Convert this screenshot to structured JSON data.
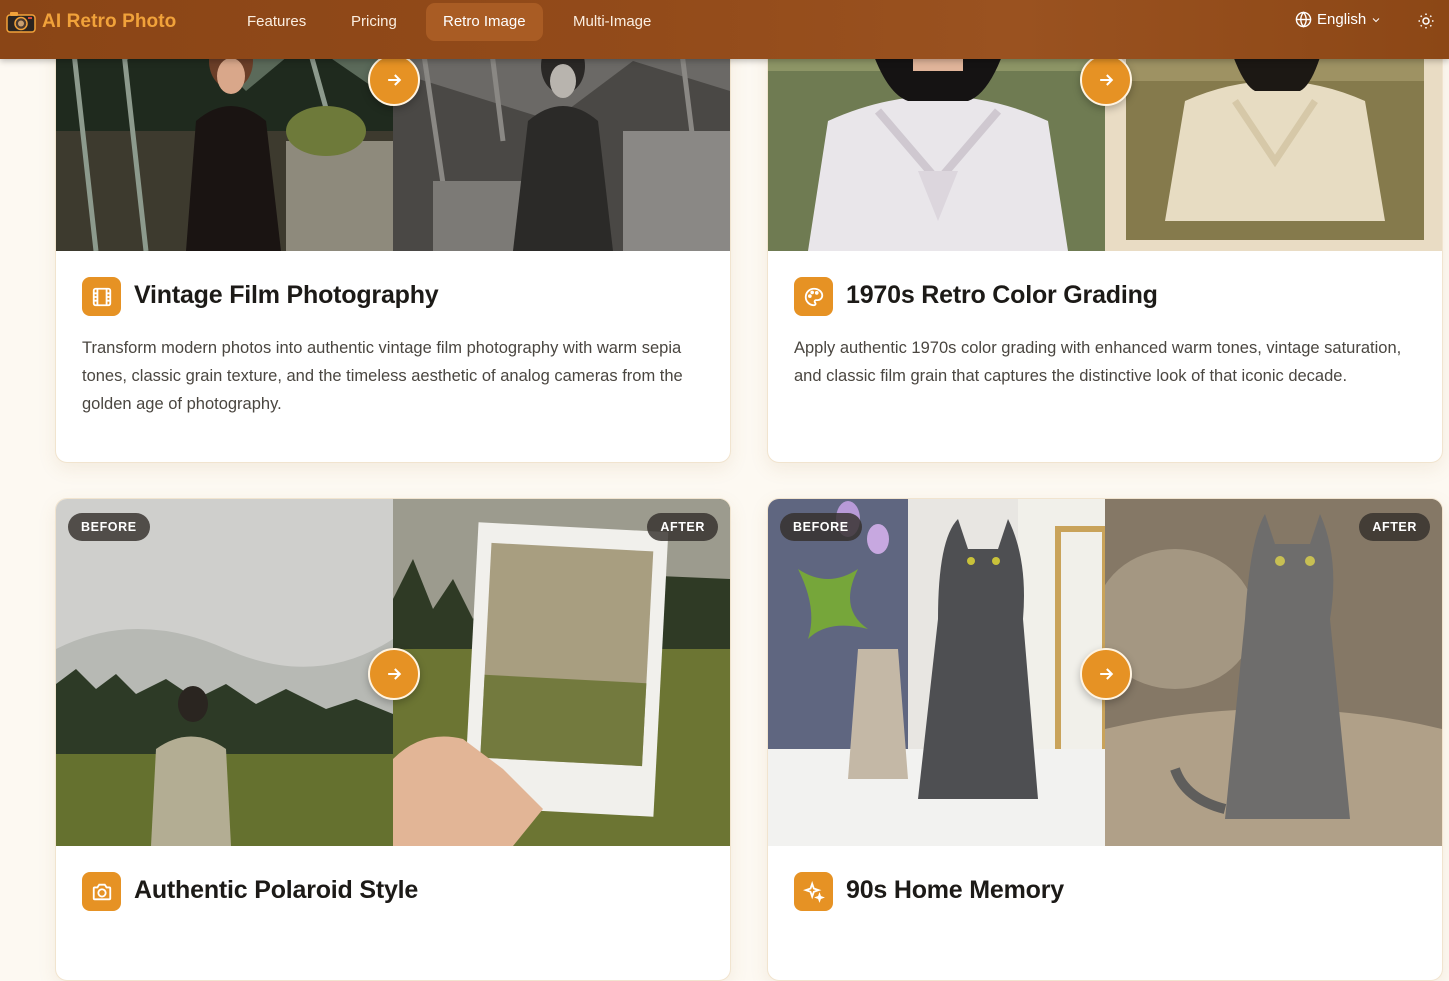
{
  "brand": {
    "name": "AI Retro Photo",
    "icon": "camera-icon"
  },
  "nav": {
    "items": [
      {
        "label": "Features",
        "active": false
      },
      {
        "label": "Pricing",
        "active": false
      },
      {
        "label": "Retro Image",
        "active": true
      },
      {
        "label": "Multi-Image",
        "active": false
      }
    ],
    "language": "English",
    "theme_icon": "sun-icon"
  },
  "colors": {
    "accent": "#e69224",
    "nav_bg": "#934b1a",
    "brand_text": "#f1a23a",
    "page_bg": "#fdf9f2"
  },
  "cards": [
    {
      "title": "Vintage Film Photography",
      "icon": "film-icon",
      "description": "Transform modern photos into authentic vintage film photography with warm sepia tones, classic grain texture, and the timeless aesthetic of analog cameras from the golden age of photography.",
      "before_label": "",
      "after_label": ""
    },
    {
      "title": "1970s Retro Color Grading",
      "icon": "palette-icon",
      "description": "Apply authentic 1970s color grading with enhanced warm tones, vintage saturation, and classic film grain that captures the distinctive look of that iconic decade.",
      "before_label": "",
      "after_label": ""
    },
    {
      "title": "Authentic Polaroid Style",
      "icon": "camera-small-icon",
      "description": "",
      "before_label": "BEFORE",
      "after_label": "AFTER"
    },
    {
      "title": "90s Home Memory",
      "icon": "sparkles-icon",
      "description": "",
      "before_label": "BEFORE",
      "after_label": "AFTER"
    }
  ]
}
